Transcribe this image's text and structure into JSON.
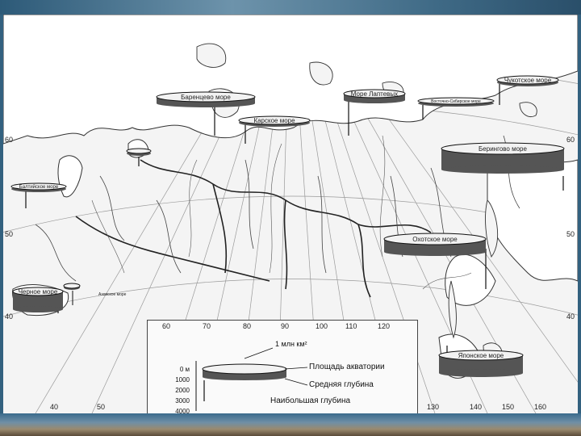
{
  "seas": [
    {
      "id": "barents",
      "label": "Баренцево море"
    },
    {
      "id": "kara",
      "label": "Карское море"
    },
    {
      "id": "laptev",
      "label": "Море Лаптевых"
    },
    {
      "id": "east_siberian",
      "label": "Восточно-Сибирское море"
    },
    {
      "id": "chukchi",
      "label": "Чукотское море"
    },
    {
      "id": "bering",
      "label": "Берингово море"
    },
    {
      "id": "okhotsk",
      "label": "Охотское море"
    },
    {
      "id": "japan",
      "label": "Японское море"
    },
    {
      "id": "baltic",
      "label": "Балтийское море"
    },
    {
      "id": "black",
      "label": "Черное море"
    },
    {
      "id": "azov",
      "label": "Азовское море"
    },
    {
      "id": "white",
      "label": ""
    }
  ],
  "latitude_labels_left": [
    "60",
    "50",
    "40"
  ],
  "latitude_labels_right": [
    "60",
    "50",
    "40"
  ],
  "longitude_labels_top": [
    "60",
    "70",
    "80",
    "90",
    "100",
    "110",
    "120"
  ],
  "longitude_labels_bottom": [
    "40",
    "50",
    "130",
    "140",
    "150",
    "160"
  ],
  "legend": {
    "area_scale": "1 млн км²",
    "depth_ticks": [
      "0 м",
      "1000",
      "2000",
      "3000",
      "4000"
    ],
    "area_label": "Площадь акватории",
    "avg_depth_label": "Средняя глубина",
    "max_depth_label": "Наибольшая глубина"
  },
  "colors": {
    "disk_fill": "#555555",
    "disk_top": "#f2f2f2",
    "land": "#f4f4f4",
    "frame": "#3f6a86"
  }
}
